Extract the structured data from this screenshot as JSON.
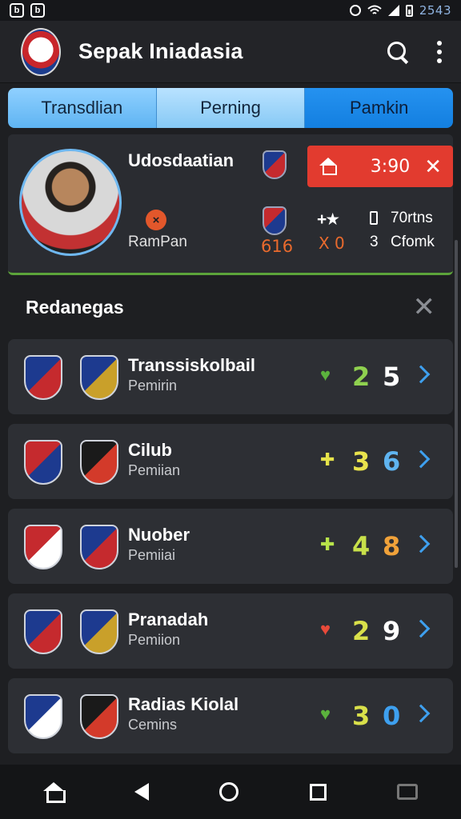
{
  "status_bar": {
    "time": "2543",
    "left_icons": [
      "app-icon-1",
      "app-icon-2"
    ],
    "left_icon_glyphs": [
      "b",
      "b"
    ]
  },
  "app_bar": {
    "title": "Sepak Iniadasia"
  },
  "tabs": [
    {
      "label": "Transdlian"
    },
    {
      "label": "Perning"
    },
    {
      "label": "Pamkin"
    }
  ],
  "player": {
    "name": "Udosdaatian",
    "club": "RamPan",
    "score_left": "616",
    "live_time": "3:90",
    "stars_text": "+★",
    "x_text": "X 0",
    "stat_value": "70rtns",
    "stat_three": "3",
    "stat_label": "Cfomk",
    "orange_chip": "×"
  },
  "section": {
    "title": "Redanegas"
  },
  "matches": [
    {
      "club": "Transsiskolbail",
      "sub": "Pemirin",
      "icon": "♥",
      "icon_color": "#5bb23d",
      "score_a": "2",
      "score_a_color": "#8fd14f",
      "score_b": "5",
      "score_b_color": "#ffffff"
    },
    {
      "club": "Cilub",
      "sub": "Pemiian",
      "icon": "✚",
      "icon_color": "#e6e34a",
      "score_a": "3",
      "score_a_color": "#e9e34d",
      "score_b": "6",
      "score_b_color": "#5fb4f0"
    },
    {
      "club": "Nuober",
      "sub": "Pemiiai",
      "icon": "✚",
      "icon_color": "#b8e34a",
      "score_a": "4",
      "score_a_color": "#c8e04a",
      "score_b": "8",
      "score_b_color": "#f0a23a"
    },
    {
      "club": "Pranadah",
      "sub": "Pemiion",
      "icon": "♥",
      "icon_color": "#e84a3a",
      "score_a": "2",
      "score_a_color": "#d9e04a",
      "score_b": "9",
      "score_b_color": "#ffffff"
    },
    {
      "club": "Radias Kiolal",
      "sub": "Cemins",
      "icon": "♥",
      "icon_color": "#5bb23d",
      "score_a": "3",
      "score_a_color": "#d9e04a",
      "score_b": "0",
      "score_b_color": "#3ea0ef"
    }
  ],
  "crest_colors": [
    [
      "#1d3a8f",
      "#c52a2e"
    ],
    [
      "#1d3a8f",
      "#c9a02a"
    ],
    [
      "#c52a2e",
      "#1d3a8f"
    ],
    [
      "#1a1a1a",
      "#d33a2a"
    ],
    [
      "#c52a2e",
      "#ffffff"
    ],
    [
      "#1d3a8f",
      "#c52a2e"
    ],
    [
      "#1d3a8f",
      "#c52a2e"
    ],
    [
      "#1d3a8f",
      "#c9a02a"
    ],
    [
      "#1d3a8f",
      "#ffffff"
    ],
    [
      "#1a1a1a",
      "#d33a2a"
    ]
  ]
}
